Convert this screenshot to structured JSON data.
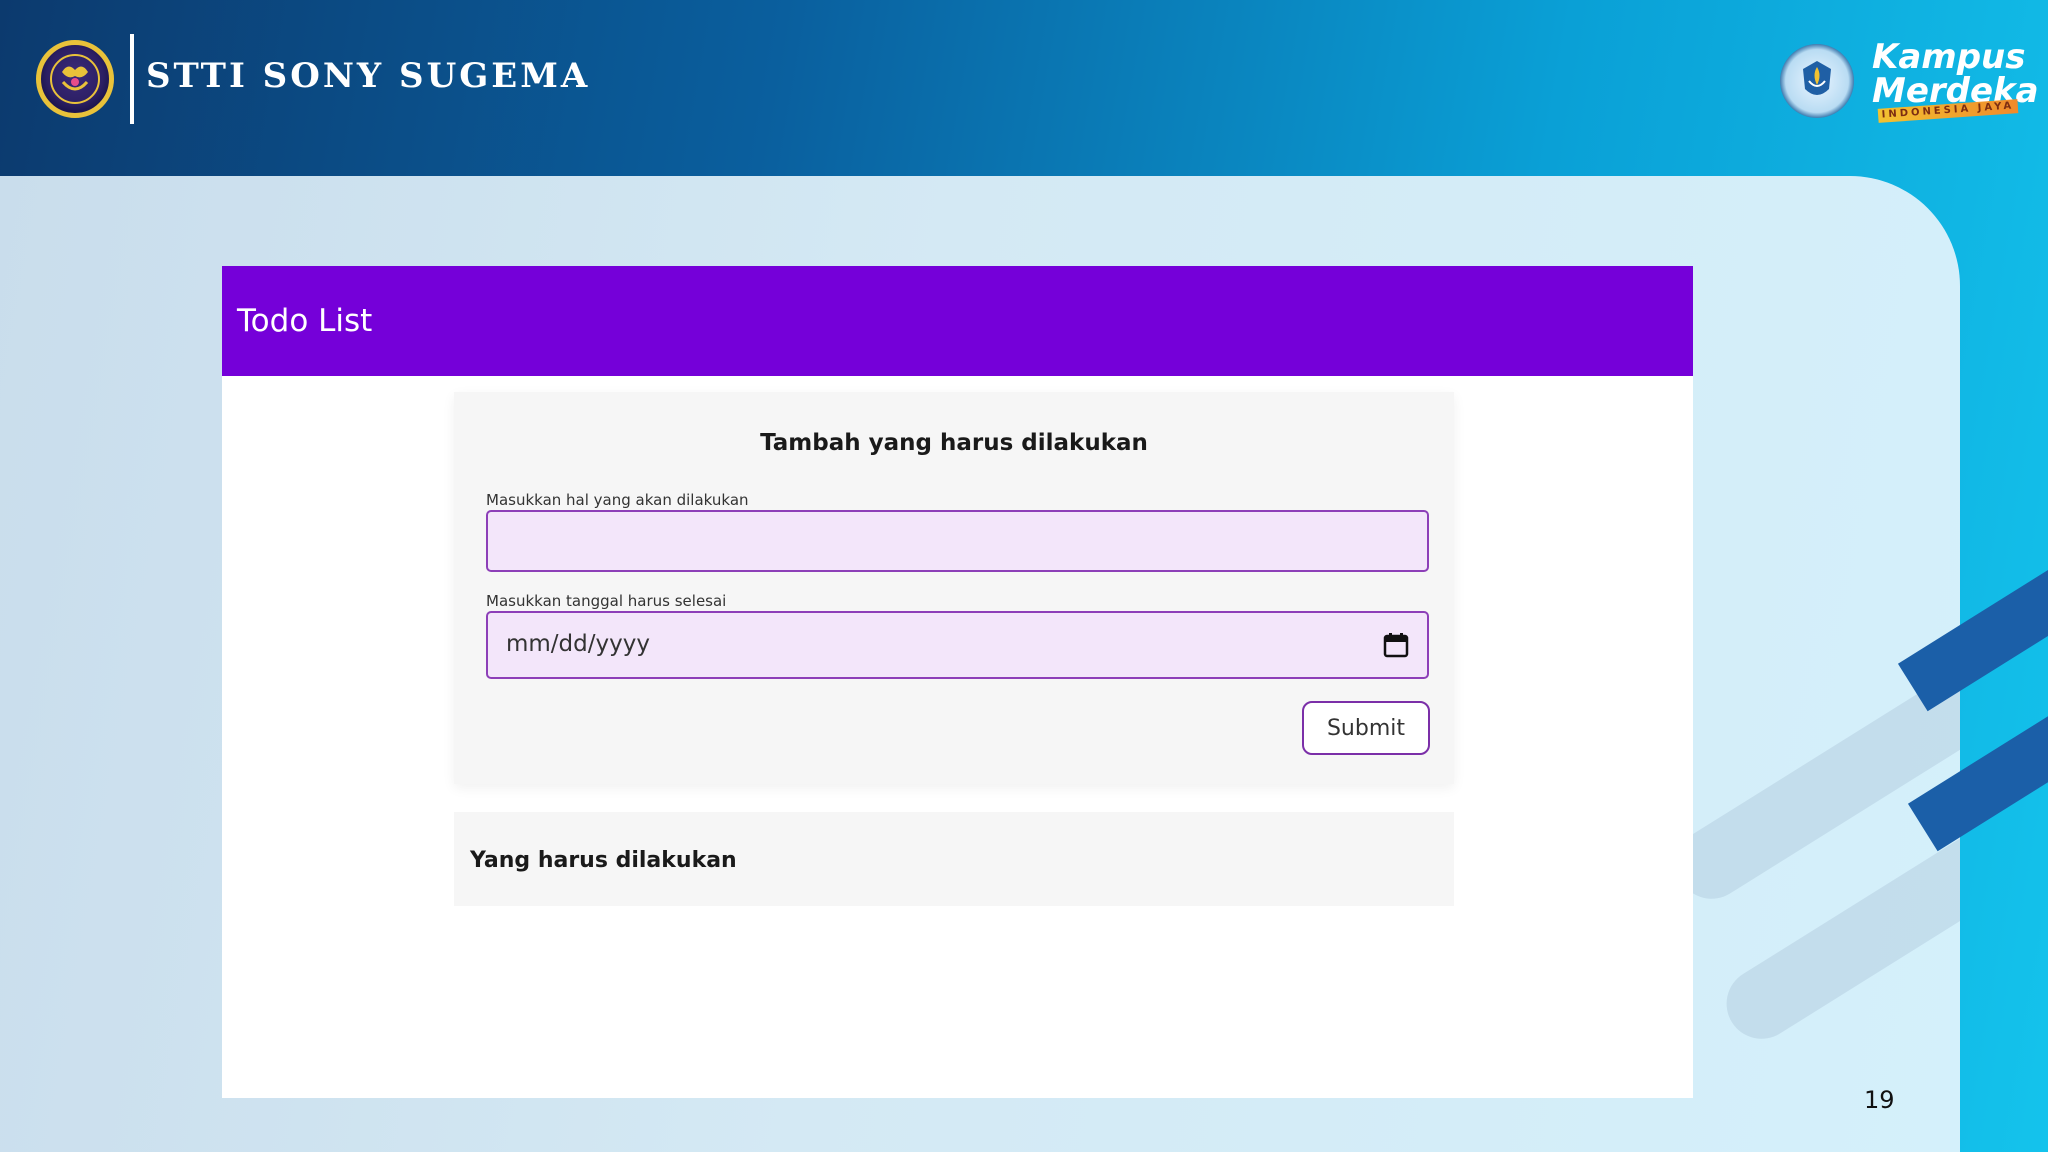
{
  "header": {
    "institution_name": "STTI SONY SUGEMA",
    "kampus_line1": "Kampus",
    "kampus_line2": "Merdeka",
    "kampus_tagline": "INDONESIA JAYA"
  },
  "app": {
    "title": "Todo List",
    "form": {
      "heading": "Tambah yang harus dilakukan",
      "task_label": "Masukkan hal yang akan dilakukan",
      "task_value": "",
      "date_label": "Masukkan tanggal harus selesai",
      "date_placeholder": "mm/dd/yyyy",
      "submit_label": "Submit"
    },
    "list": {
      "title": "Yang harus dilakukan"
    }
  },
  "slide": {
    "page_number": "19"
  },
  "colors": {
    "app_header": "#7500d9",
    "input_border": "#8d3fb8",
    "input_background": "#f3e6fa"
  },
  "icons": {
    "institution_logo": "stti-logo-icon",
    "kemendikbud_emblem": "tut-wuri-handayani-icon",
    "date_picker": "calendar-icon"
  }
}
